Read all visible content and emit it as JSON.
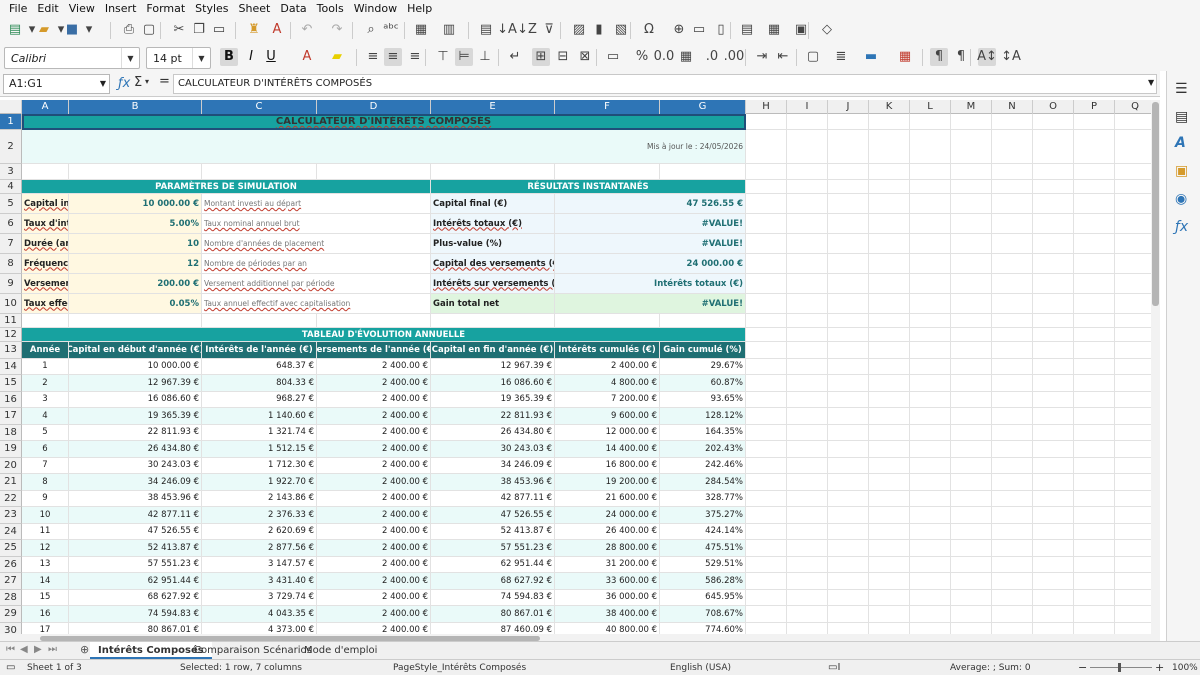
{
  "menu": [
    "File",
    "Edit",
    "View",
    "Insert",
    "Format",
    "Styles",
    "Sheet",
    "Data",
    "Tools",
    "Window",
    "Help"
  ],
  "toolbar": {
    "font_name": "Calibri",
    "font_size": "14 pt"
  },
  "formula_bar": {
    "name_box": "A1:G1",
    "content": "CALCULATEUR D'INTÉRÊTS COMPOSÉS"
  },
  "columns": [
    "A",
    "B",
    "C",
    "D",
    "E",
    "F",
    "G",
    "H",
    "I",
    "J",
    "K",
    "L",
    "M",
    "N",
    "O",
    "P",
    "Q"
  ],
  "sheet": {
    "title": "CALCULATEUR D'INTÉRÊTS COMPOSÉS",
    "updated": "Mis à jour le : 24/05/2026",
    "params_header": "PARAMÈTRES DE SIMULATION",
    "results_header": "RÉSULTATS INSTANTANÉS",
    "params": [
      {
        "label": "Capital initia",
        "value": "10 000.00 €",
        "desc": "Montant investi au départ"
      },
      {
        "label": "Taux d'intér",
        "value": "5.00%",
        "desc": "Taux nominal annuel brut"
      },
      {
        "label": "Durée (anné",
        "value": "10",
        "desc": "Nombre d'années de placement"
      },
      {
        "label": "Fréquence d",
        "value": "12",
        "desc": "Nombre de périodes par an"
      },
      {
        "label": "Versement a",
        "value": "200.00 €",
        "desc": "Versement additionnel par période"
      },
      {
        "label": "Taux effecti",
        "value": "0.05%",
        "desc": "Taux annuel effectif avec capitalisation"
      }
    ],
    "results": [
      {
        "label": "Capital final (€)",
        "value": "47 526.55 €"
      },
      {
        "label": "Intérêts totaux (€)",
        "value": "#VALUE!"
      },
      {
        "label": "Plus-value (%)",
        "value": "#VALUE!"
      },
      {
        "label": "Capital des versements (€)",
        "value": "24 000.00 €"
      },
      {
        "label": "Intérêts sur versements (€)",
        "value": "Intérêts totaux (€)"
      },
      {
        "label": "Gain total net",
        "value": "#VALUE!"
      }
    ],
    "table_title": "TABLEAU D'ÉVOLUTION ANNUELLE",
    "table_headers": [
      "Année",
      "Capital en début d'année (€)",
      "Intérêts de l'année (€)",
      "Versements de l'année (€)",
      "Capital en fin d'année (€)",
      "Intérêts cumulés (€)",
      "Gain cumulé (%)"
    ],
    "table_rows": [
      [
        "1",
        "10 000.00 €",
        "648.37 €",
        "2 400.00 €",
        "12 967.39 €",
        "2 400.00 €",
        "29.67%"
      ],
      [
        "2",
        "12 967.39 €",
        "804.33 €",
        "2 400.00 €",
        "16 086.60 €",
        "4 800.00 €",
        "60.87%"
      ],
      [
        "3",
        "16 086.60 €",
        "968.27 €",
        "2 400.00 €",
        "19 365.39 €",
        "7 200.00 €",
        "93.65%"
      ],
      [
        "4",
        "19 365.39 €",
        "1 140.60 €",
        "2 400.00 €",
        "22 811.93 €",
        "9 600.00 €",
        "128.12%"
      ],
      [
        "5",
        "22 811.93 €",
        "1 321.74 €",
        "2 400.00 €",
        "26 434.80 €",
        "12 000.00 €",
        "164.35%"
      ],
      [
        "6",
        "26 434.80 €",
        "1 512.15 €",
        "2 400.00 €",
        "30 243.03 €",
        "14 400.00 €",
        "202.43%"
      ],
      [
        "7",
        "30 243.03 €",
        "1 712.30 €",
        "2 400.00 €",
        "34 246.09 €",
        "16 800.00 €",
        "242.46%"
      ],
      [
        "8",
        "34 246.09 €",
        "1 922.70 €",
        "2 400.00 €",
        "38 453.96 €",
        "19 200.00 €",
        "284.54%"
      ],
      [
        "9",
        "38 453.96 €",
        "2 143.86 €",
        "2 400.00 €",
        "42 877.11 €",
        "21 600.00 €",
        "328.77%"
      ],
      [
        "10",
        "42 877.11 €",
        "2 376.33 €",
        "2 400.00 €",
        "47 526.55 €",
        "24 000.00 €",
        "375.27%"
      ],
      [
        "11",
        "47 526.55 €",
        "2 620.69 €",
        "2 400.00 €",
        "52 413.87 €",
        "26 400.00 €",
        "424.14%"
      ],
      [
        "12",
        "52 413.87 €",
        "2 877.56 €",
        "2 400.00 €",
        "57 551.23 €",
        "28 800.00 €",
        "475.51%"
      ],
      [
        "13",
        "57 551.23 €",
        "3 147.57 €",
        "2 400.00 €",
        "62 951.44 €",
        "31 200.00 €",
        "529.51%"
      ],
      [
        "14",
        "62 951.44 €",
        "3 431.40 €",
        "2 400.00 €",
        "68 627.92 €",
        "33 600.00 €",
        "586.28%"
      ],
      [
        "15",
        "68 627.92 €",
        "3 729.74 €",
        "2 400.00 €",
        "74 594.83 €",
        "36 000.00 €",
        "645.95%"
      ],
      [
        "16",
        "74 594.83 €",
        "4 043.35 €",
        "2 400.00 €",
        "80 867.01 €",
        "38 400.00 €",
        "708.67%"
      ],
      [
        "17",
        "80 867.01 €",
        "4 373.00 €",
        "2 400.00 €",
        "87 460.09 €",
        "40 800.00 €",
        "774.60%"
      ]
    ]
  },
  "tabs": [
    "Intérêts Composés",
    "Comparaison Scénarios",
    "Mode d'emploi"
  ],
  "status": {
    "sheet": "Sheet 1 of 3",
    "selection": "Selected: 1 row, 7 columns",
    "pagestyle": "PageStyle_Intérêts Composés",
    "language": "English (USA)",
    "summary": "Average: ; Sum: 0",
    "zoom": "100%"
  },
  "colors": {
    "teal_band": "#17a2a0",
    "dark_teal": "#1f6f73",
    "selection": "#2e75b6"
  }
}
